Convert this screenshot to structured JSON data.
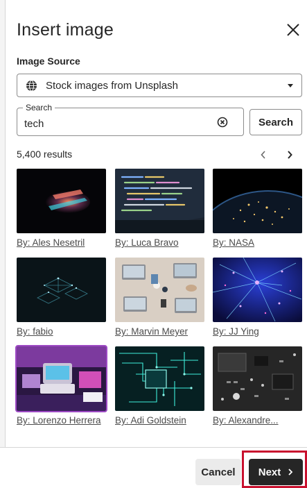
{
  "dialog": {
    "title": "Insert image"
  },
  "image_source": {
    "label": "Image Source",
    "selected": "Stock images from Unsplash"
  },
  "search": {
    "legend": "Search",
    "value": "tech",
    "button_label": "Search"
  },
  "results": {
    "count_text": "5,400 results"
  },
  "images": [
    {
      "caption": "By: Ales Nesetril"
    },
    {
      "caption": "By: Luca Bravo"
    },
    {
      "caption": "By: NASA"
    },
    {
      "caption": "By: fabio"
    },
    {
      "caption": "By: Marvin Meyer"
    },
    {
      "caption": "By: JJ Ying"
    },
    {
      "caption": "By: Lorenzo Herrera"
    },
    {
      "caption": "By: Adi Goldstein"
    },
    {
      "caption": "By: Alexandre..."
    }
  ],
  "footer": {
    "cancel_label": "Cancel",
    "next_label": "Next"
  },
  "icons": {
    "close": "close-icon",
    "globe": "globe-icon",
    "caret": "chevron-down-icon",
    "clear": "clear-icon",
    "prev": "chevron-left-icon",
    "next": "chevron-right-icon"
  },
  "colors": {
    "primary": "#262626",
    "selected_outline": "#9d49c4",
    "highlight": "#c8102e"
  }
}
